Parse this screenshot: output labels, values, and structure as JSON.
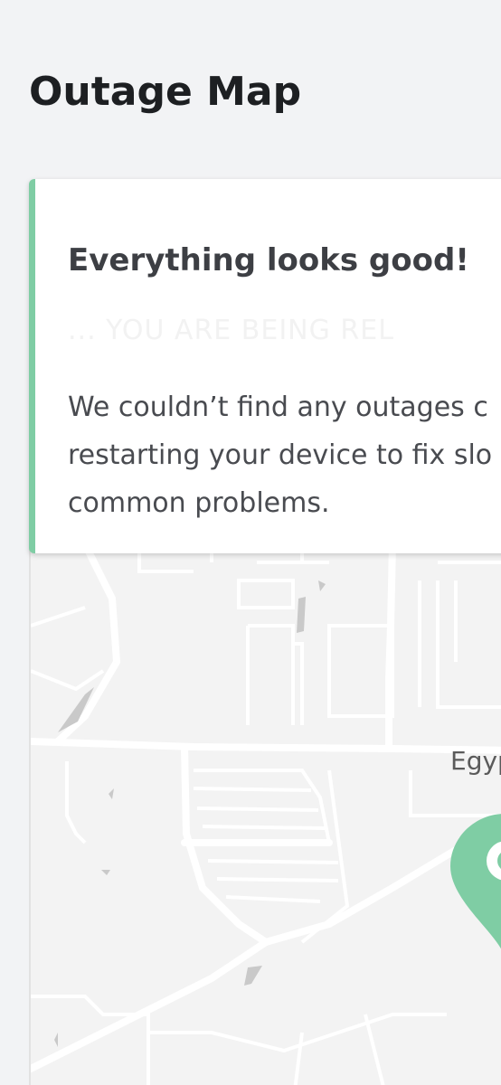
{
  "header": {
    "title": "Outage Map"
  },
  "status_card": {
    "heading": "Everything looks good!",
    "faded_text": "... YOU ARE BEING REL",
    "message": "We couldn’t find any outages c\nrestarting your device to fix slo\ncommon problems.",
    "accent_color": "#7fcda4"
  },
  "map": {
    "place_label": "Egyp",
    "marker": {
      "icon": "location-pin-icon",
      "color": "#7fcda4"
    }
  }
}
